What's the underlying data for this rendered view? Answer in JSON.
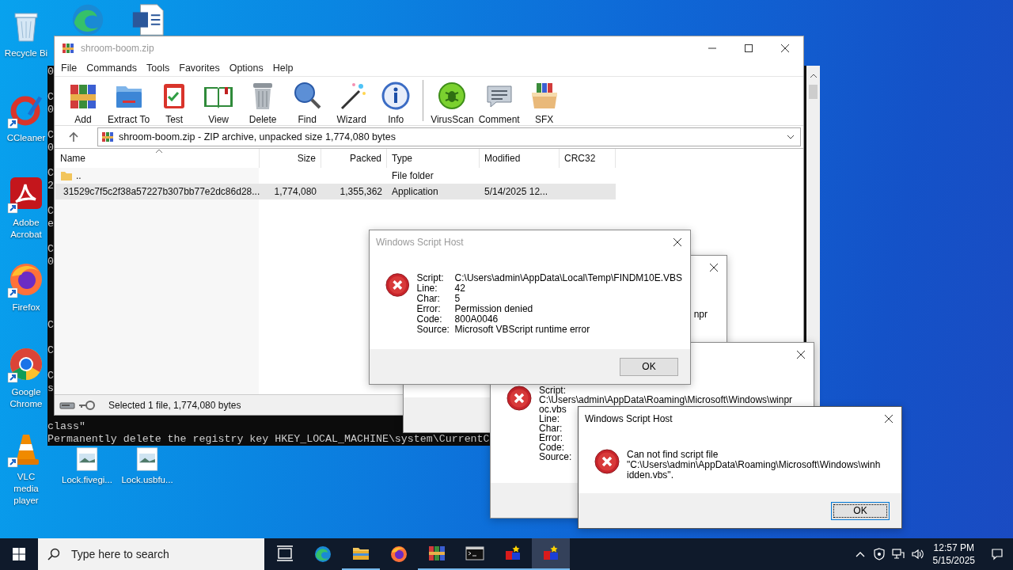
{
  "desktop": {
    "icons": [
      {
        "kind": "recycle_bin",
        "label": "Recycle Bi"
      },
      {
        "kind": "ccleaner",
        "label": "CCleaner"
      },
      {
        "kind": "acrobat",
        "label": "Adobe Acrobat"
      },
      {
        "kind": "firefox",
        "label": "Firefox"
      },
      {
        "kind": "chrome",
        "label": "Google Chrome"
      },
      {
        "kind": "vlc",
        "label": "VLC media player"
      }
    ],
    "partly_hidden_icons": [
      {
        "kind": "edge"
      },
      {
        "kind": "word"
      }
    ],
    "files": [
      {
        "label": "Lock.fivegi..."
      },
      {
        "label": "Lock.usbfu..."
      }
    ]
  },
  "console": {
    "lines": [
      {
        "text": "0"
      },
      {
        "text": "C"
      },
      {
        "text": "0"
      },
      {
        "text": "C"
      },
      {
        "text": "0"
      },
      {
        "text": "C"
      },
      {
        "text": "2"
      },
      {
        "text": "C"
      },
      {
        "text": "e"
      },
      {
        "text": "C"
      },
      {
        "text": "0"
      },
      {
        "text": "C"
      },
      {
        "text": "C"
      },
      {
        "text": "C"
      },
      {
        "text": "s"
      },
      {
        "text": "class\""
      },
      {
        "text": "Permanently delete the registry key HKEY_LOCAL_MACHINE\\system\\CurrentC"
      }
    ]
  },
  "winrar": {
    "title": "shroom-boom.zip",
    "menu": [
      "File",
      "Commands",
      "Tools",
      "Favorites",
      "Options",
      "Help"
    ],
    "toolbar": [
      {
        "kind": "add",
        "label": "Add"
      },
      {
        "kind": "extract",
        "label": "Extract To"
      },
      {
        "kind": "test",
        "label": "Test"
      },
      {
        "kind": "view",
        "label": "View"
      },
      {
        "kind": "delete",
        "label": "Delete"
      },
      {
        "kind": "find",
        "label": "Find"
      },
      {
        "kind": "wizard",
        "label": "Wizard"
      },
      {
        "kind": "info",
        "label": "Info"
      },
      {
        "kind": "separator"
      },
      {
        "kind": "virusscan",
        "label": "VirusScan"
      },
      {
        "kind": "comment",
        "label": "Comment"
      },
      {
        "kind": "sfx",
        "label": "SFX"
      }
    ],
    "address": "shroom-boom.zip - ZIP archive, unpacked size 1,774,080 bytes",
    "columns": [
      "Name",
      "Size",
      "Packed",
      "Type",
      "Modified",
      "CRC32"
    ],
    "rows": [
      {
        "kind": "folder",
        "selected": false,
        "name": "..",
        "type": "File folder"
      },
      {
        "kind": "application",
        "selected": true,
        "name": "31529c7f5c2f38a57227b307bb77e2dc86d28...",
        "size": "1,774,080",
        "packed": "1,355,362",
        "type": "Application",
        "modified": "5/14/2025 12..."
      }
    ],
    "status": "Selected 1 file, 1,774,080 bytes"
  },
  "dialogs": [
    {
      "kind": "fragment",
      "text": "npr"
    },
    {
      "kind": "lines",
      "lines": [
        "Script:",
        "C:\\Users\\admin\\AppData\\Roaming\\Microsoft\\Windows\\winpr",
        "oc.vbs",
        "Line:",
        "Char:",
        "Error:",
        "Code:",
        "Source:"
      ]
    },
    {
      "kind": "fields",
      "title": "Windows Script Host",
      "active": false,
      "fields": [
        {
          "label": "Script:",
          "value": "C:\\Users\\admin\\AppData\\Local\\Temp\\FINDM10E.VBS"
        },
        {
          "label": "Line:",
          "value": "42"
        },
        {
          "label": "Char:",
          "value": "5"
        },
        {
          "label": "Error:",
          "value": "Permission denied"
        },
        {
          "label": "Code:",
          "value": "800A0046"
        },
        {
          "label": "Source:",
          "value": "Microsoft VBScript runtime error"
        }
      ],
      "button": {
        "label": "OK",
        "focused": false
      }
    },
    {
      "kind": "message",
      "title": "Windows Script Host",
      "active": true,
      "lines": [
        "Can not find script file",
        "\"C:\\Users\\admin\\AppData\\Roaming\\Microsoft\\Windows\\winh",
        "idden.vbs\"."
      ],
      "button": {
        "label": "OK",
        "focused": true
      }
    }
  ],
  "taskbar": {
    "search_placeholder": "Type here to search",
    "items": [
      {
        "kind": "task_view",
        "running": false,
        "active": false
      },
      {
        "kind": "edge",
        "running": false,
        "active": false
      },
      {
        "kind": "explorer",
        "running": true,
        "active": false
      },
      {
        "kind": "firefox",
        "running": false,
        "active": false
      },
      {
        "kind": "winrar",
        "running": true,
        "active": false
      },
      {
        "kind": "terminal",
        "running": true,
        "active": false
      },
      {
        "kind": "app",
        "running": true,
        "active": false
      },
      {
        "kind": "app",
        "running": true,
        "active": true
      }
    ],
    "clock": {
      "time": "12:57 PM",
      "date": "5/15/2025"
    }
  }
}
